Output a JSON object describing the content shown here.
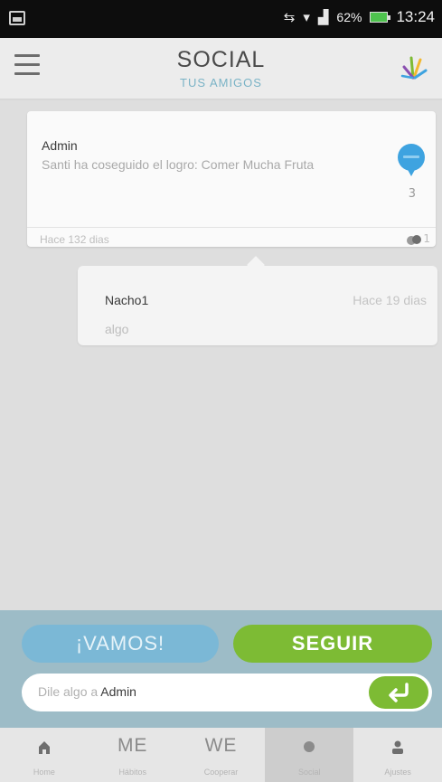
{
  "status_bar": {
    "battery": "62%",
    "time": "13:24",
    "battery_color": "#4ec24e"
  },
  "header": {
    "title": "SOCIAL",
    "subtitle": "TUS AMIGOS",
    "menu_icon": "hamburger-icon",
    "logo_icon": "app-logo-icon"
  },
  "post": {
    "author": "Admin",
    "text": "Santi ha coseguido el logro: Comer Mucha Fruta",
    "badge_count": "3",
    "time": "Hace 132 dias",
    "comment_count": "1",
    "badge_color": "#3ea3e0"
  },
  "reply": {
    "author": "Nacho1",
    "time": "Hace 19 dias",
    "text": "algo"
  },
  "actions": {
    "vamos_label": "¡VAMOS!",
    "seguir_label": "SEGUIR",
    "input_prefix": "Dile algo a",
    "input_name": "Admin",
    "vamos_color": "#7bb8d6",
    "seguir_color": "#7dbb34"
  },
  "nav": {
    "items": [
      {
        "label": "Home",
        "glyph": "",
        "icon": "home-icon"
      },
      {
        "label": "Hábitos",
        "glyph": "ME",
        "icon": "me-icon"
      },
      {
        "label": "Cooperar",
        "glyph": "WE",
        "icon": "we-icon"
      },
      {
        "label": "Social",
        "glyph": "",
        "icon": "social-dot-icon",
        "active": true
      },
      {
        "label": "Ajustes",
        "glyph": "",
        "icon": "user-icon"
      }
    ]
  }
}
